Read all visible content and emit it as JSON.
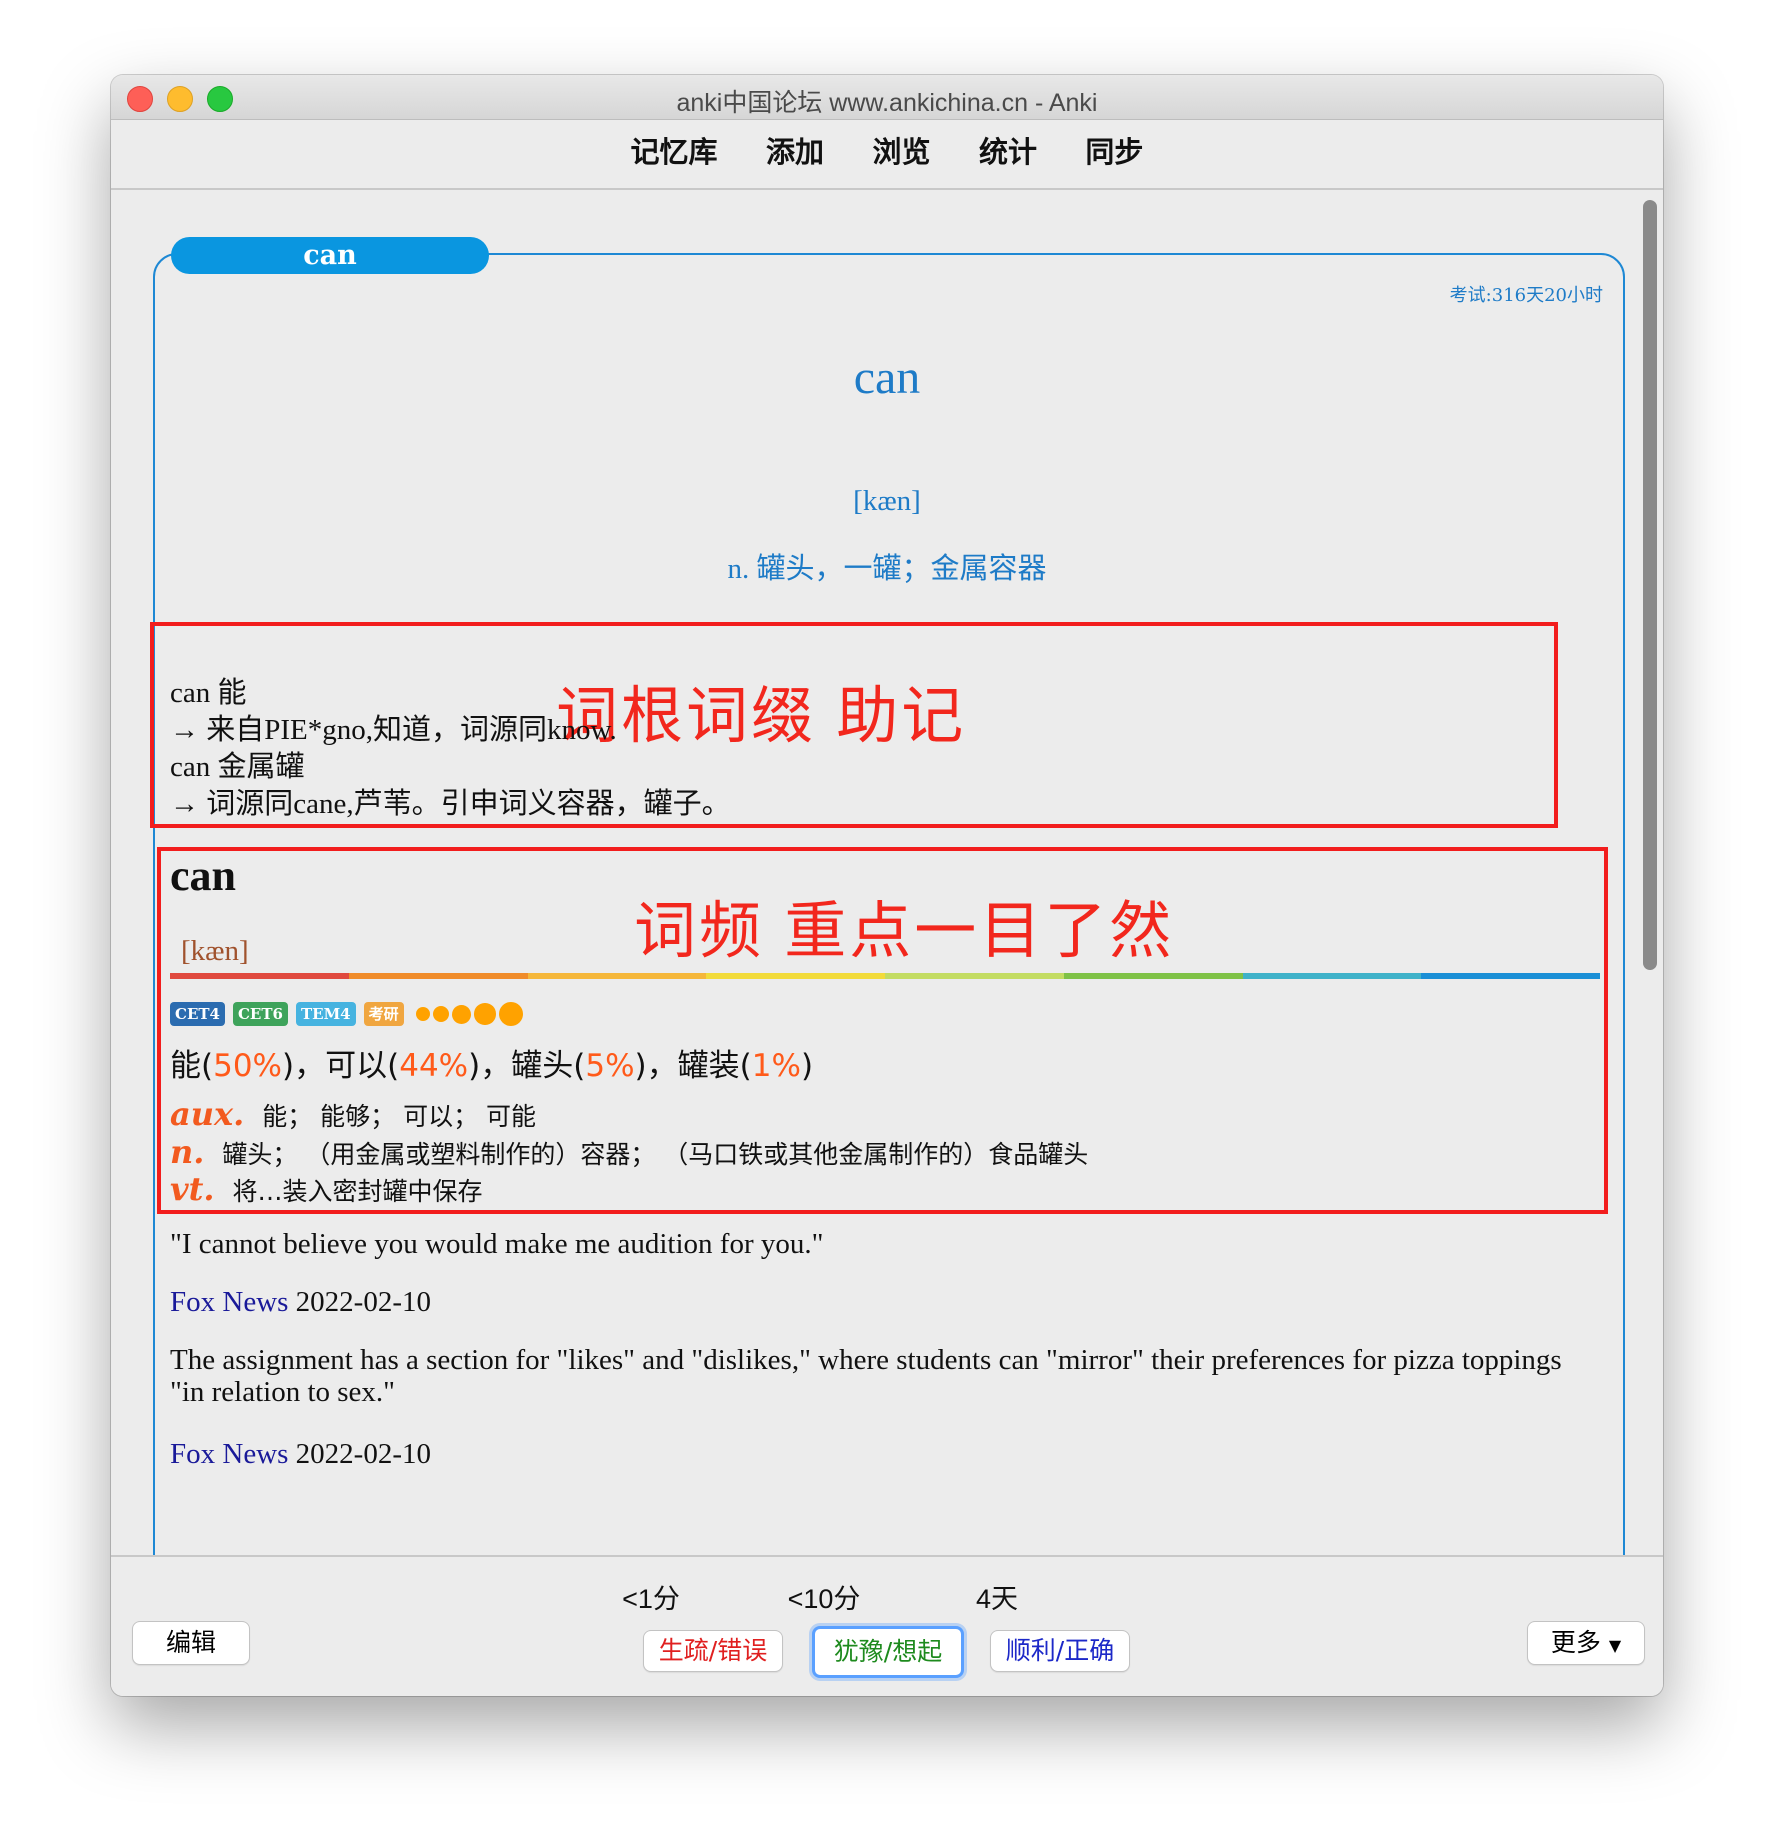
{
  "window": {
    "title": "anki中国论坛 www.ankichina.cn - Anki"
  },
  "toolbar": {
    "items": [
      "记忆库",
      "添加",
      "浏览",
      "统计",
      "同步"
    ]
  },
  "card": {
    "word_tab": "can",
    "exam_countdown": "考试:316天20小时",
    "headword": "can",
    "phonetic": "[kæn]",
    "meaning": "n. 罐头，一罐；金属容器",
    "etymology_annotation": "词根词缀 助记",
    "etymology_lines": [
      "can 能",
      "→ 来自PIE*gno,知道，词源同know.",
      "can 金属罐",
      "→ 词源同cane,芦苇。引申词义容器，罐子。"
    ],
    "frequency_annotation": "词频 重点一目了然",
    "freq_word": "can",
    "freq_phonetic": "[kæn]",
    "tags": [
      {
        "label": "CET4",
        "color": "#2b6cb0"
      },
      {
        "label": "CET6",
        "color": "#3ea35b"
      },
      {
        "label": "TEM4",
        "color": "#46b3e0"
      },
      {
        "label": "考研",
        "color": "#f0a640"
      }
    ],
    "star_level": 5,
    "freq_meanings": [
      {
        "word": "能",
        "pct": "50%"
      },
      {
        "word": "可以",
        "pct": "44%"
      },
      {
        "word": "罐头",
        "pct": "5%"
      },
      {
        "word": "罐装",
        "pct": "1%"
      }
    ],
    "definitions": [
      {
        "pos": "aux.",
        "text": "能； 能够； 可以； 可能"
      },
      {
        "pos": "n.",
        "text": "罐头； （用金属或塑料制作的）容器； （马口铁或其他金属制作的）食品罐头"
      },
      {
        "pos": "vt.",
        "text": "将…装入密封罐中保存"
      }
    ],
    "sentences": [
      {
        "text": "\"I cannot believe you would make me audition for you.\"",
        "source": "Fox News",
        "date": "2022-02-10"
      },
      {
        "text": "The assignment has a section for \"likes\" and \"dislikes,\" where students can \"mirror\" their preferences for pizza toppings \"in relation to sex.\"",
        "source": "Fox News",
        "date": "2022-02-10"
      }
    ]
  },
  "colors": {
    "rainbow": [
      "#e0493e",
      "#f08c2a",
      "#f5b73a",
      "#f2db3a",
      "#c3dc62",
      "#7fc246",
      "#3fb2c9",
      "#1a8fd6"
    ]
  },
  "bottom": {
    "edit_label": "编辑",
    "more_label": "更多",
    "answers": [
      {
        "time": "<1分",
        "label": "生疏/错误",
        "color": "#e02020"
      },
      {
        "time": "<10分",
        "label": "犹豫/想起",
        "color": "#1d8a1d"
      },
      {
        "time": "4天",
        "label": "顺利/正确",
        "color": "#1c28c8"
      }
    ]
  }
}
